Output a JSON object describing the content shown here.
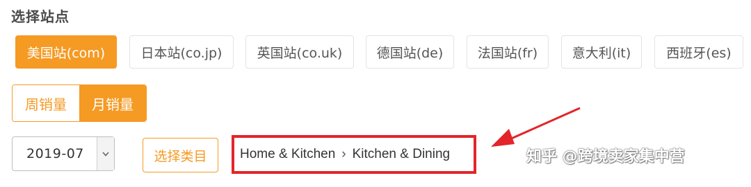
{
  "section_title": "选择站点",
  "sites": [
    {
      "label": "美国站(com)",
      "active": true
    },
    {
      "label": "日本站(co.jp)",
      "active": false
    },
    {
      "label": "英国站(co.uk)",
      "active": false
    },
    {
      "label": "德国站(de)",
      "active": false
    },
    {
      "label": "法国站(fr)",
      "active": false
    },
    {
      "label": "意大利(it)",
      "active": false
    },
    {
      "label": "西班牙(es)",
      "active": false
    }
  ],
  "period": {
    "weekly_label": "周销量",
    "monthly_label": "月销量",
    "selected": "monthly"
  },
  "month_select": {
    "value": "2019-07"
  },
  "category_button": {
    "label": "选择类目"
  },
  "breadcrumb": {
    "items": [
      "Home & Kitchen",
      "Kitchen & Dining"
    ],
    "separator": "›"
  },
  "watermark": {
    "text": "知乎 @跨境卖家集中营",
    "icon": "wechat-icon"
  },
  "colors": {
    "accent": "#f59a23",
    "highlight_box": "#e3242b",
    "annotation_arrow": "#e3242b"
  }
}
